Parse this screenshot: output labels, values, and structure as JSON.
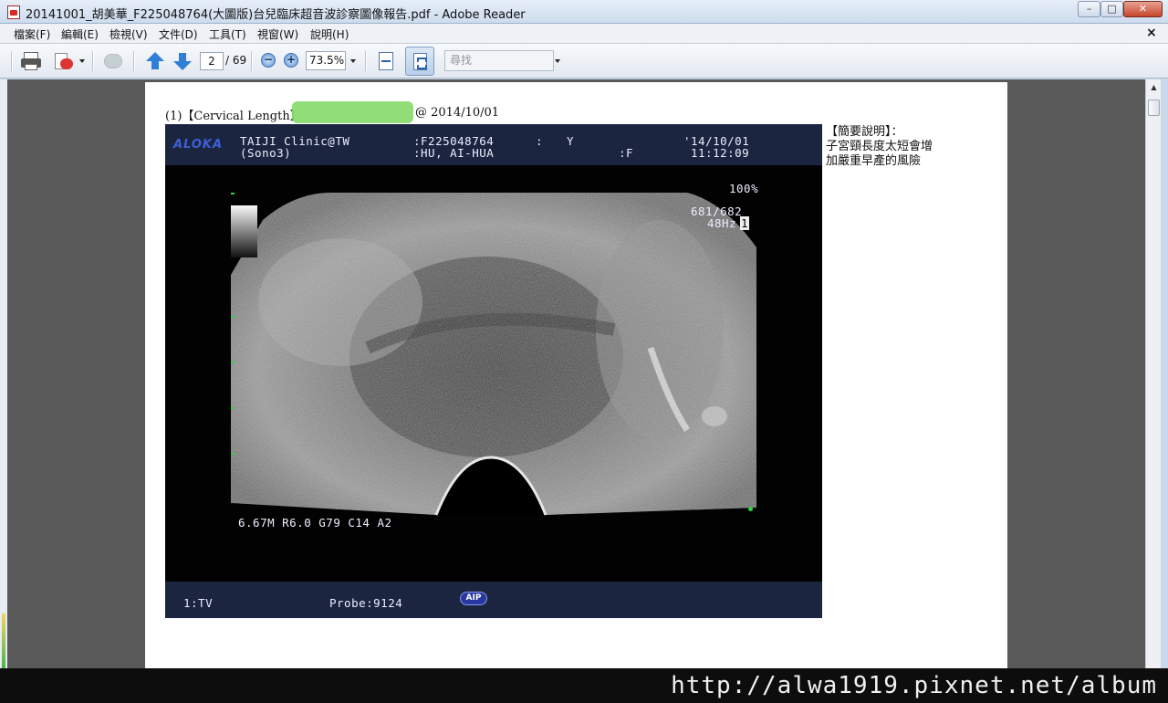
{
  "window": {
    "title": "20141001_胡美華_F225048764(大圖版)台兒臨床超音波診察圖像報告.pdf - Adobe Reader",
    "min_glyph": "–",
    "max_glyph": "□",
    "close_glyph": "✕"
  },
  "menu": {
    "items": [
      "檔案(F)",
      "編輯(E)",
      "檢視(V)",
      "文件(D)",
      "工具(T)",
      "視窗(W)",
      "說明(H)"
    ],
    "close_glyph": "×"
  },
  "toolbar": {
    "page_current": "2",
    "page_total": "/ 69",
    "zoom_out_glyph": "−",
    "zoom_in_glyph": "+",
    "zoom_value": "73.5%",
    "search_placeholder": "尋找",
    "icons": [
      "print-icon",
      "create-pdf-icon",
      "collaborate-icon",
      "previous-page-icon",
      "next-page-icon",
      "zoom-out-icon",
      "zoom-in-icon",
      "fit-width-icon",
      "fit-page-icon"
    ]
  },
  "document": {
    "heading_prefix": "(1)【Cervical Length】",
    "heading_suffix": "@ 2014/10/01",
    "summary_title": "【簡要說明】：",
    "summary_line1": "子宮頸長度太短會增",
    "summary_line2": "加嚴重早產的風險"
  },
  "ultrasound": {
    "brand": "ALOKA",
    "clinic": "TAIJI Clinic@TW",
    "model": "(Sono3)",
    "patient_id": ":F225048764",
    "sep": ":",
    "flag": "Y",
    "patient_name": ":HU, AI-HUA",
    "sex": ":F",
    "date": "'14/10/01",
    "time": "11:12:09",
    "gain_pct": "100%",
    "frame": "681/682",
    "rate": "48Hz",
    "rate_box": "1",
    "params": "6.67M R6.0 G79 C14 A2",
    "mode": "1:TV",
    "probe": "Probe:9124",
    "aip": "AIP"
  },
  "watermark": "http://alwa1919.pixnet.net/album",
  "colors": {
    "accent": "#2f7fd8",
    "us_header": "#1b2540",
    "brand": "#3f5fd6",
    "redaction": "#8bdc72",
    "marker": "#2fd43a"
  }
}
